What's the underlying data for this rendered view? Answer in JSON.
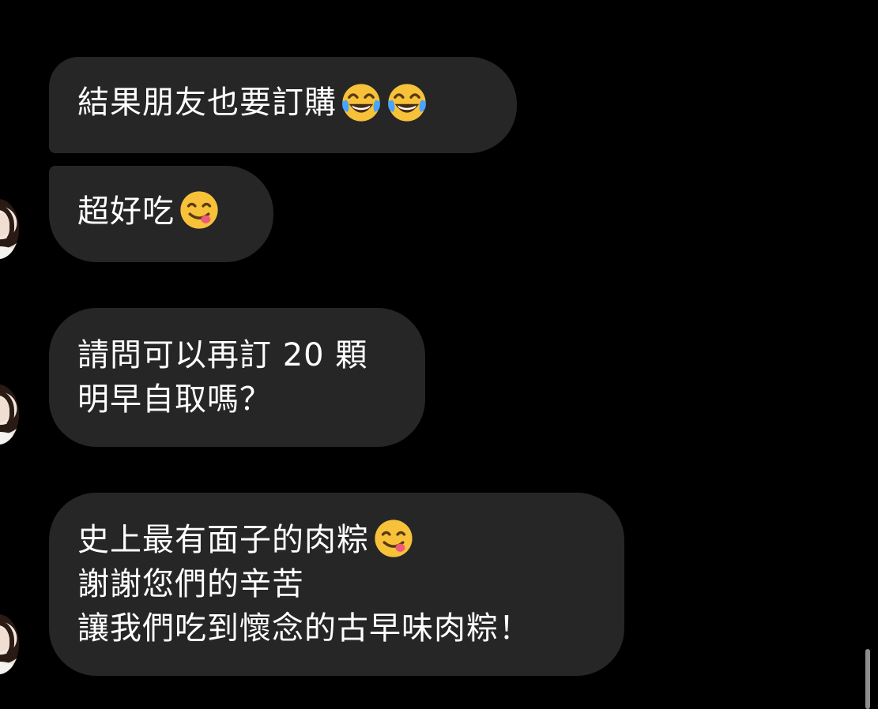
{
  "messages": [
    {
      "text": "結果朋友也要訂購",
      "emojis": [
        "😂",
        "😂"
      ],
      "has_avatar": false
    },
    {
      "text": "超好吃",
      "emojis": [
        "😋"
      ],
      "has_avatar": true
    },
    {
      "lines": [
        "請問可以再訂 20 顆",
        "明早自取嗎？"
      ],
      "has_avatar": true
    },
    {
      "lines": [
        "史上最有面子的肉粽",
        "謝謝您們的辛苦",
        "讓我們吃到懷念的古早味肉粽！"
      ],
      "line1_emojis": [
        "😋"
      ],
      "has_avatar": true
    }
  ],
  "icons": {
    "laugh_cry": "face-with-tears-of-joy-icon",
    "yum": "face-savoring-food-icon",
    "avatar": "user-avatar"
  },
  "colors": {
    "background": "#000000",
    "bubble": "#262626",
    "text": "#ffffff",
    "scrollbar": "#8e8e8e"
  }
}
